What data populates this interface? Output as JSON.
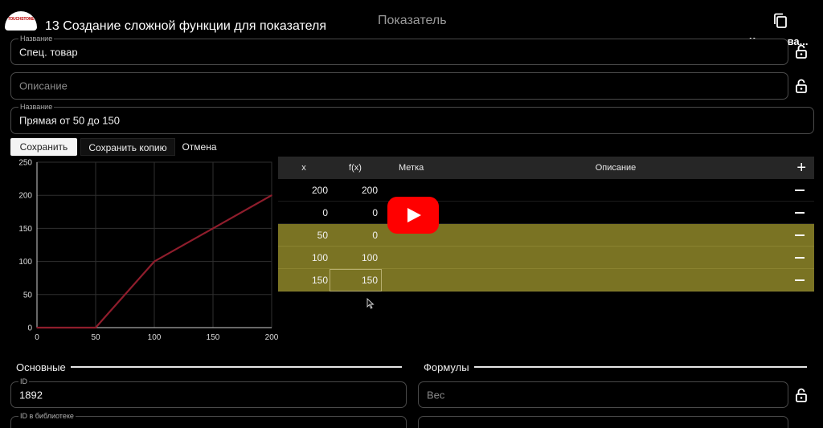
{
  "video": {
    "title": "13 Создание сложной функции для показателя",
    "logo_text": "TOUCHSTONE"
  },
  "window": {
    "title": "Показатель",
    "copy_label": "Копирова..."
  },
  "fields": {
    "name_top": {
      "label": "Название",
      "value": "Спец. товар"
    },
    "description": {
      "placeholder": "Описание"
    },
    "name": {
      "label": "Название",
      "value": "Прямая от 50 до 150"
    }
  },
  "buttons": {
    "save": "Сохранить",
    "save_copy": "Сохранить копию",
    "cancel": "Отмена"
  },
  "chart_data": {
    "type": "line",
    "x": [
      0,
      50,
      100,
      150,
      200
    ],
    "series": [
      {
        "values": [
          0,
          0,
          100,
          150,
          200
        ]
      }
    ],
    "xlim": [
      0,
      200
    ],
    "ylim": [
      0,
      250
    ],
    "x_ticks": [
      "0",
      "50",
      "100",
      "150",
      "200"
    ],
    "y_ticks": [
      "0",
      "50",
      "100",
      "150",
      "200",
      "250"
    ],
    "grid": true,
    "line_color": "#8f1d2c",
    "title": "",
    "xlabel": "",
    "ylabel": ""
  },
  "table": {
    "headers": {
      "x": "x",
      "fx": "f(x)",
      "mark": "Метка",
      "description": "Описание"
    },
    "rows": [
      {
        "x": "200",
        "fx": "200",
        "highlighted": false
      },
      {
        "x": "0",
        "fx": "0",
        "highlighted": false
      },
      {
        "x": "50",
        "fx": "0",
        "highlighted": true
      },
      {
        "x": "100",
        "fx": "100",
        "highlighted": true
      },
      {
        "x": "150",
        "fx": "150",
        "highlighted": true
      }
    ],
    "highlight_color": "#7a7323"
  },
  "sections": {
    "basic": {
      "title": "Основные"
    },
    "formulas": {
      "title": "Формулы"
    }
  },
  "basic_fields": {
    "id": {
      "label": "ID",
      "value": "1892"
    },
    "library_id": {
      "label": "ID в библиотеке"
    }
  },
  "formula_fields": {
    "weight": {
      "placeholder": "Вес"
    }
  }
}
